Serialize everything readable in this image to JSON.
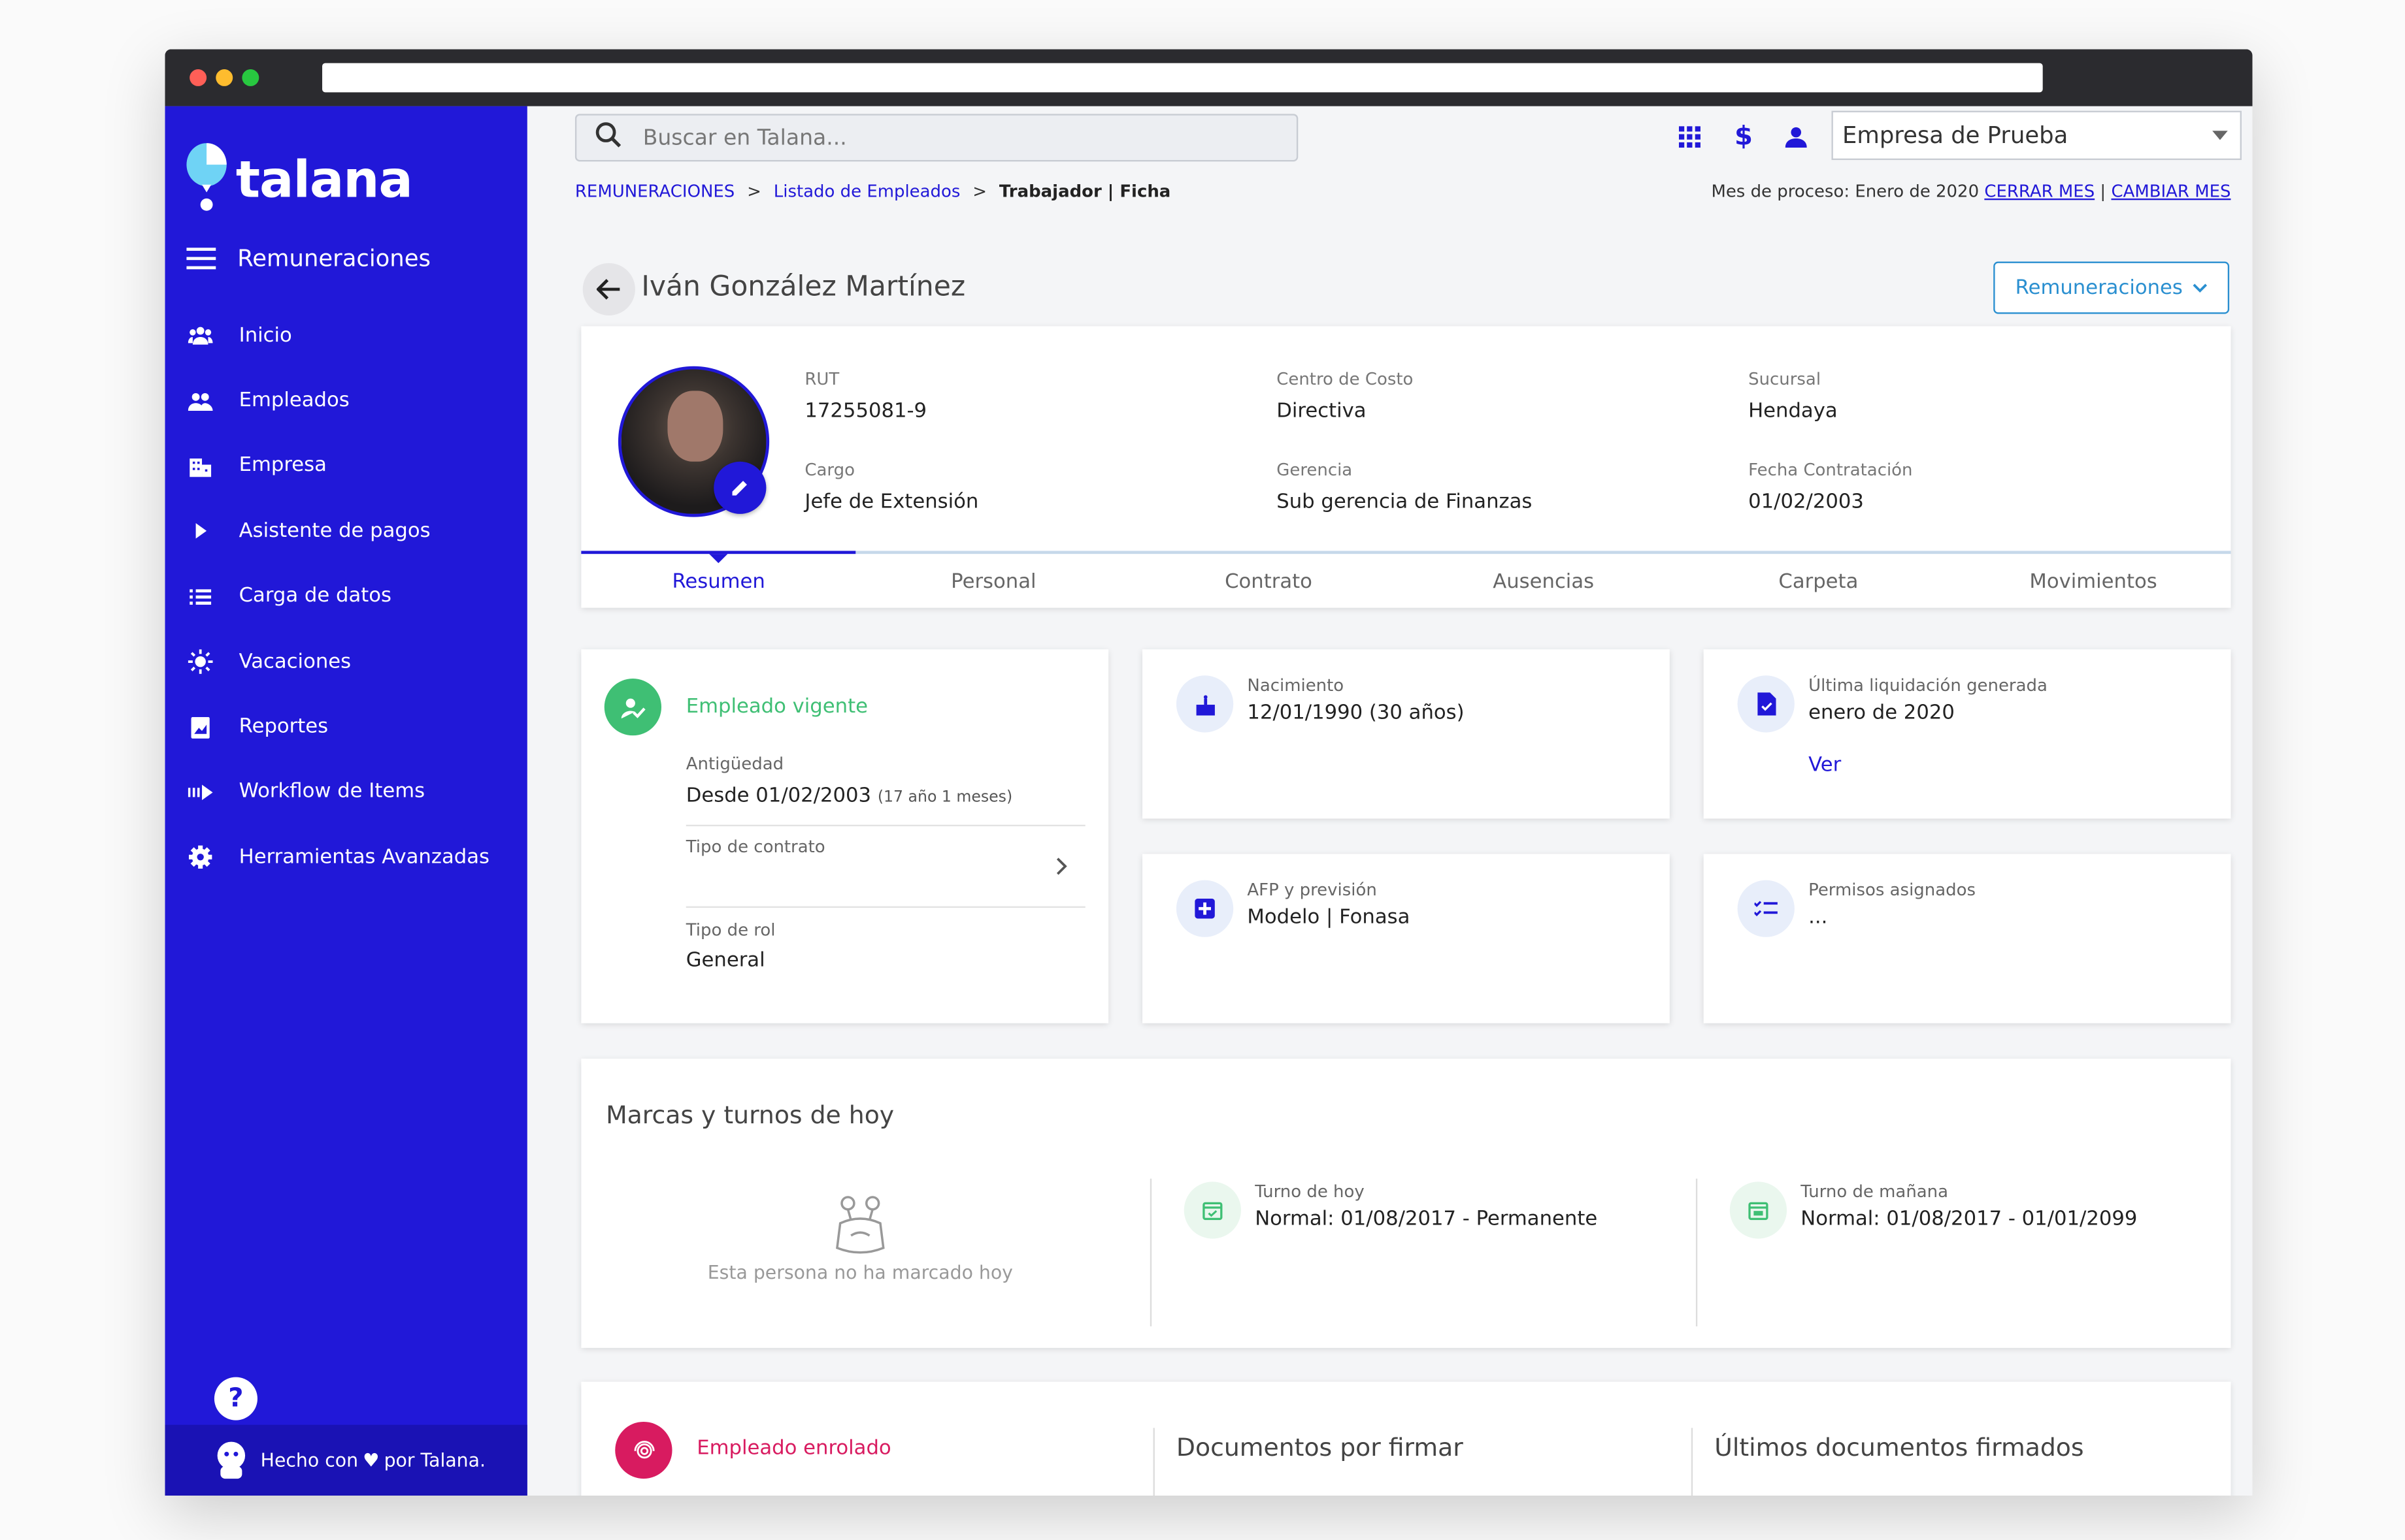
{
  "app": {
    "name": "talana"
  },
  "sidebar": {
    "module": "Remuneraciones",
    "items": [
      {
        "label": "Inicio",
        "icon": "users-icon"
      },
      {
        "label": "Empleados",
        "icon": "people-icon"
      },
      {
        "label": "Empresa",
        "icon": "building-icon"
      },
      {
        "label": "Asistente de pagos",
        "icon": "play-icon"
      },
      {
        "label": "Carga de datos",
        "icon": "list-icon"
      },
      {
        "label": "Vacaciones",
        "icon": "sun-icon"
      },
      {
        "label": "Reportes",
        "icon": "report-icon"
      },
      {
        "label": "Workflow de Items",
        "icon": "workflow-icon"
      },
      {
        "label": "Herramientas Avanzadas",
        "icon": "gear-icon"
      }
    ],
    "footer_before": "Hecho con",
    "footer_after": "por Talana."
  },
  "header": {
    "search_placeholder": "Buscar en Talana...",
    "company": "Empresa de Prueba"
  },
  "breadcrumb": {
    "items": [
      "REMUNERACIONES",
      "Listado de Empleados"
    ],
    "separator": ">",
    "current": "Trabajador | Ficha"
  },
  "process": {
    "label": "Mes de proceso: Enero de 2020",
    "close": "CERRAR MES",
    "divider": "|",
    "change": "CAMBIAR MES"
  },
  "employee": {
    "name": "Iván González Martínez",
    "module_button": "Remuneraciones",
    "fields": {
      "rut_label": "RUT",
      "rut": "17255081-9",
      "cargo_label": "Cargo",
      "cargo": "Jefe de Extensión",
      "centro_label": "Centro de Costo",
      "centro": "Directiva",
      "gerencia_label": "Gerencia",
      "gerencia": "Sub gerencia de Finanzas",
      "sucursal_label": "Sucursal",
      "sucursal": "Hendaya",
      "fecha_label": "Fecha Contratación",
      "fecha": "01/02/2003"
    }
  },
  "tabs": [
    "Resumen",
    "Personal",
    "Contrato",
    "Ausencias",
    "Carpeta",
    "Movimientos"
  ],
  "status_card": {
    "status": "Empleado vigente",
    "antiguedad_label": "Antigüedad",
    "antiguedad": "Desde 01/02/2003",
    "antiguedad_note": "(17 año 1 meses)",
    "contrato_label": "Tipo de contrato",
    "rol_label": "Tipo de rol",
    "rol": "General"
  },
  "birth_card": {
    "label": "Nacimiento",
    "value": "12/01/1990 (30 años)"
  },
  "liquidacion_card": {
    "label": "Última liquidación generada",
    "value": "enero de 2020",
    "link": "Ver"
  },
  "afp_card": {
    "label": "AFP y previsión",
    "value": "Modelo | Fonasa"
  },
  "permisos_card": {
    "label": "Permisos asignados",
    "value": "..."
  },
  "turnos": {
    "title": "Marcas y turnos de hoy",
    "empty": "Esta persona no ha marcado hoy",
    "today_label": "Turno de hoy",
    "today": "Normal: 01/08/2017 - Permanente",
    "tomorrow_label": "Turno de mañana",
    "tomorrow": "Normal: 01/08/2017 - 01/01/2099"
  },
  "bottom": {
    "enrolado": "Empleado enrolado",
    "docs_pending": "Documentos por firmar",
    "docs_signed": "Últimos documentos firmados"
  },
  "colors": {
    "primary": "#2118d8",
    "green": "#3fbf74",
    "pink": "#d81b60",
    "link_blue": "#2a8fd0"
  }
}
